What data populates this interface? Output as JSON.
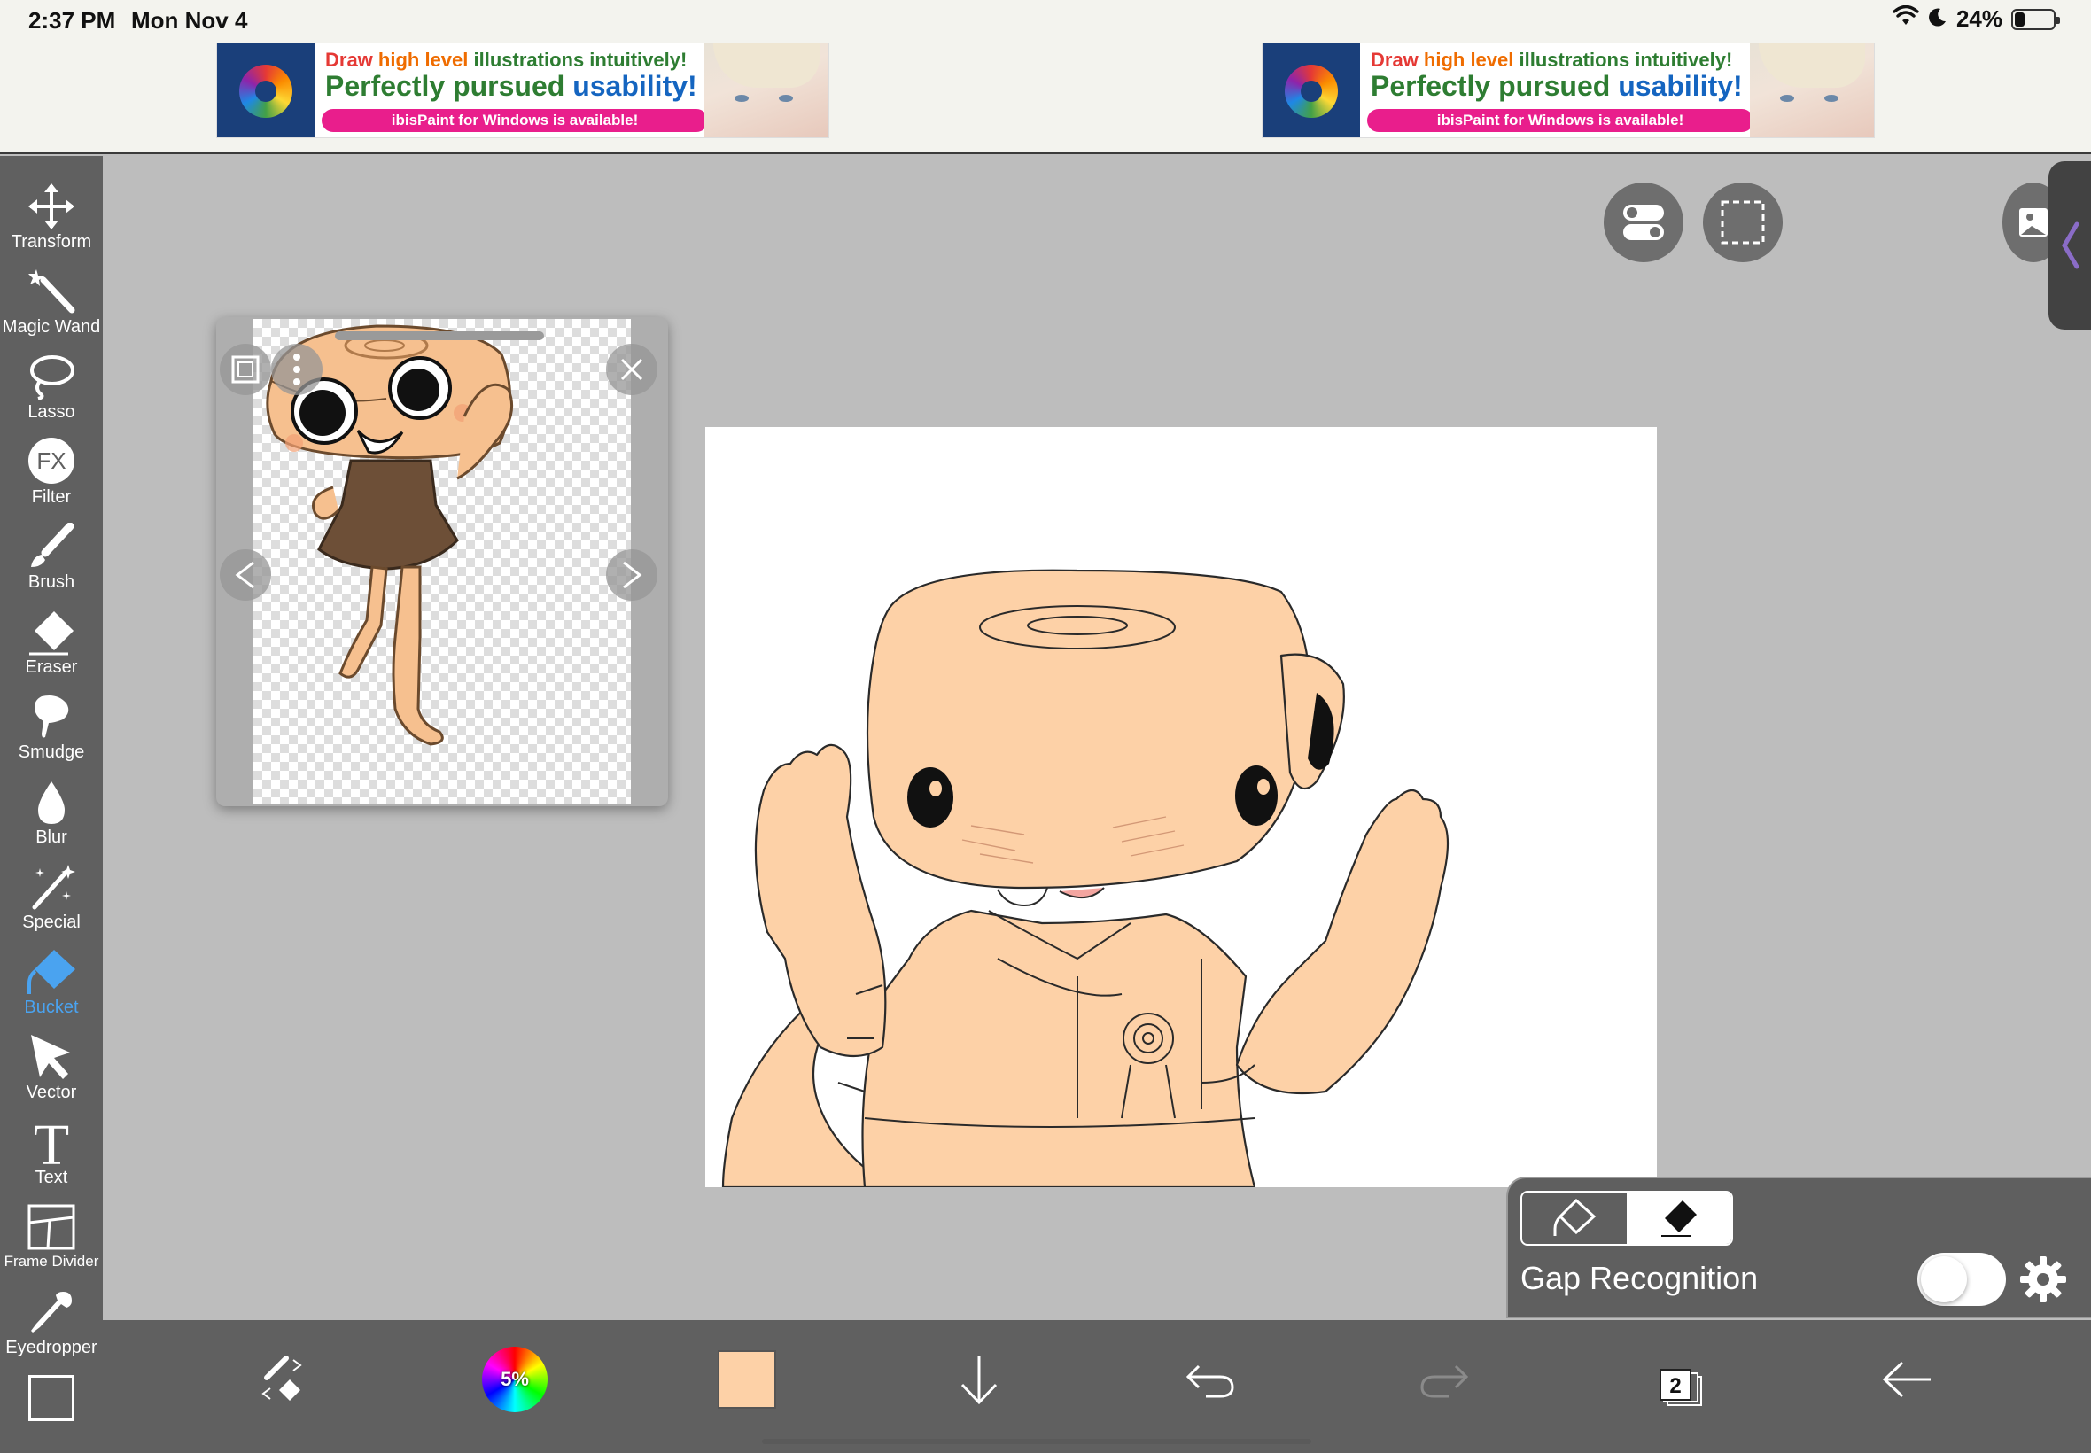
{
  "status": {
    "time": "2:37 PM",
    "date": "Mon Nov 4",
    "battery": "24%",
    "battery_level": 0.24
  },
  "ads": [
    {
      "line1_a": "Draw",
      "line1_b": " high level",
      "line1_c": " illustrations intuitively!",
      "line2_a": "Perfectly pursued",
      "line2_b": " usability!",
      "pill": "ibisPaint for Windows is available!"
    },
    {
      "line1_a": "Draw",
      "line1_b": " high level",
      "line1_c": " illustrations intuitively!",
      "line2_a": "Perfectly pursued",
      "line2_b": " usability!",
      "pill": "ibisPaint for Windows is available!"
    }
  ],
  "tools": [
    {
      "label": "Transform",
      "icon": "move-icon"
    },
    {
      "label": "Magic Wand",
      "icon": "magic-wand-icon"
    },
    {
      "label": "Lasso",
      "icon": "lasso-icon"
    },
    {
      "label": "Filter",
      "icon": "fx-icon"
    },
    {
      "label": "Brush",
      "icon": "brush-icon"
    },
    {
      "label": "Eraser",
      "icon": "eraser-icon"
    },
    {
      "label": "Smudge",
      "icon": "smudge-icon"
    },
    {
      "label": "Blur",
      "icon": "blur-drop-icon"
    },
    {
      "label": "Special",
      "icon": "sparkle-wand-icon"
    },
    {
      "label": "Bucket",
      "icon": "bucket-icon",
      "active": true
    },
    {
      "label": "Vector",
      "icon": "cursor-arrow-icon"
    },
    {
      "label": "Text",
      "icon": "text-t-icon"
    },
    {
      "label": "Frame Divider",
      "icon": "frame-divider-icon"
    },
    {
      "label": "Eyedropper",
      "icon": "eyedropper-icon"
    }
  ],
  "fill_panel": {
    "gap_label": "Gap Recognition",
    "gap_enabled": false
  },
  "bottom_bar": {
    "brush_opacity": "5%",
    "current_color": "#fdd1a7",
    "layer_count": "2"
  },
  "colors": {
    "accent": "#4aa3f0",
    "toolbar_bg": "#606060",
    "canvas_bg": "#bdbdbd",
    "skin": "#fdd1a7",
    "ad_pink": "#e91e8c"
  }
}
